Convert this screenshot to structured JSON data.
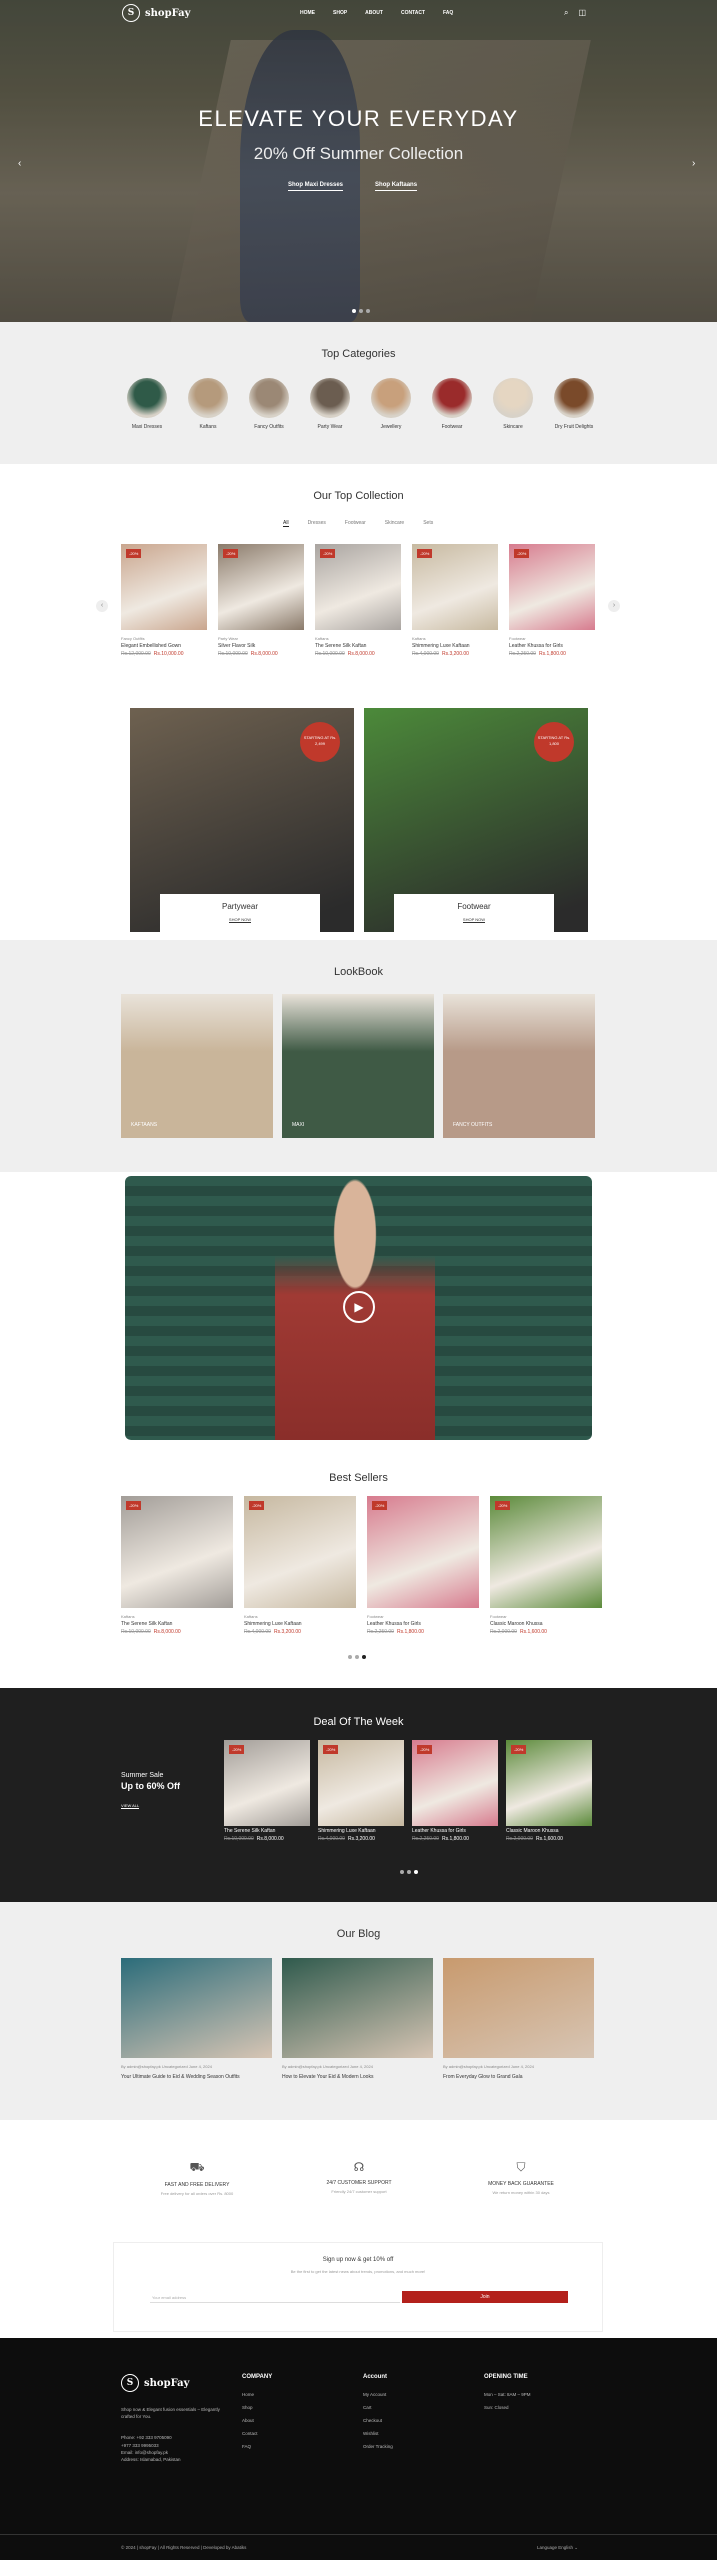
{
  "nav": {
    "logo": "shopFay",
    "menu": [
      "HOME",
      "SHOP",
      "ABOUT",
      "CONTACT",
      "FAQ"
    ]
  },
  "hero": {
    "title": "ELEVATE YOUR EVERYDAY",
    "subtitle": "20% Off Summer Collection",
    "buttons": [
      "Shop Maxi Dresses",
      "Shop Kaftaans"
    ]
  },
  "categories": {
    "title": "Top Categories",
    "items": [
      {
        "label": "Maxi Dresses",
        "color": "#2f5a48"
      },
      {
        "label": "Kaftans",
        "color": "#b59a7c"
      },
      {
        "label": "Fancy Outfits",
        "color": "#9b8875"
      },
      {
        "label": "Party Wear",
        "color": "#6b5d50"
      },
      {
        "label": "Jewellery",
        "color": "#c8a07c"
      },
      {
        "label": "Footwear",
        "color": "#9a2b2b"
      },
      {
        "label": "Skincare",
        "color": "#e5d6c2"
      },
      {
        "label": "Dry Fruit Delights",
        "color": "#7a4a2a"
      }
    ]
  },
  "collection": {
    "title": "Our Top Collection",
    "tabs": [
      "All",
      "Dresses",
      "Footwear",
      "Skincare",
      "Sets"
    ],
    "products": [
      {
        "badge": "-20%",
        "category": "Fancy Outfits",
        "name": "Elegant Embellished Gown",
        "old": "Rs.12,000.00",
        "price": "Rs.10,000.00",
        "color": "#c9a58d"
      },
      {
        "badge": "-20%",
        "category": "Party Wear",
        "name": "Silver Flavor Silk",
        "old": "Rs.10,000.00",
        "price": "Rs.8,000.00",
        "color": "#8a7a6a"
      },
      {
        "badge": "-20%",
        "category": "Kaftans",
        "name": "The Serene Silk Kaftan",
        "old": "Rs.10,000.00",
        "price": "Rs.8,000.00",
        "color": "#a9a4a0"
      },
      {
        "badge": "-20%",
        "category": "Kaftans",
        "name": "Shimmering Luxe Kaftaan",
        "old": "Rs.4,000.00",
        "price": "Rs.3,200.00",
        "color": "#c7b9a0"
      },
      {
        "badge": "-20%",
        "category": "Footwear",
        "name": "Leather Khussa for Girls",
        "old": "Rs.2,250.00",
        "price": "Rs.1,800.00",
        "color": "#d77b8e"
      }
    ]
  },
  "banners": [
    {
      "title": "Partywear",
      "cta": "SHOP NOW",
      "stamp": "STARTING AT Rs. 2,499",
      "color": "#6e6150"
    },
    {
      "title": "Footwear",
      "cta": "SHOP NOW",
      "stamp": "STARTING AT Rs. 1,800",
      "color": "#4c8a3a"
    }
  ],
  "lookbook": {
    "title": "LookBook",
    "items": [
      {
        "label": "KAFTAANS",
        "color": "#c9b59a"
      },
      {
        "label": "MAXI",
        "color": "#3f5a45"
      },
      {
        "label": "FANCY OUTFITS",
        "color": "#b79a88"
      }
    ]
  },
  "best": {
    "title": "Best Sellers",
    "products": [
      {
        "badge": "-20%",
        "category": "Kaftans",
        "name": "The Serene Silk Kaftan",
        "old": "Rs.10,000.00",
        "price": "Rs.8,000.00",
        "color": "#a29d98"
      },
      {
        "badge": "-20%",
        "category": "Kaftans",
        "name": "Shimmering Luxe Kaftaan",
        "old": "Rs.4,000.00",
        "price": "Rs.3,200.00",
        "color": "#c6b8a0"
      },
      {
        "badge": "-20%",
        "category": "Footwear",
        "name": "Leather Khussa for Girls",
        "old": "Rs.2,250.00",
        "price": "Rs.1,800.00",
        "color": "#d77b8e"
      },
      {
        "badge": "-20%",
        "category": "Footwear",
        "name": "Classic Maroon Khussa",
        "old": "Rs.2,000.00",
        "price": "Rs.1,600.00",
        "color": "#5b8a3a"
      }
    ]
  },
  "deal": {
    "title": "Deal Of The Week",
    "side_a": "Summer Sale",
    "side_b": "Up to 60% Off",
    "side_cta": "VIEW ALL",
    "products": [
      {
        "badge": "-20%",
        "name": "The Serene Silk Kaftan",
        "old": "Rs.10,000.00",
        "price": "Rs.8,000.00",
        "color": "#a29d98"
      },
      {
        "badge": "-20%",
        "name": "Shimmering Luxe Kaftaan",
        "old": "Rs.4,000.00",
        "price": "Rs.3,200.00",
        "color": "#c6b8a0"
      },
      {
        "badge": "-20%",
        "name": "Leather Khussa for Girls",
        "old": "Rs.2,250.00",
        "price": "Rs.1,800.00",
        "color": "#d77b8e"
      },
      {
        "badge": "-20%",
        "name": "Classic Maroon Khussa",
        "old": "Rs.2,000.00",
        "price": "Rs.1,600.00",
        "color": "#5b8a3a"
      }
    ]
  },
  "blog": {
    "title": "Our Blog",
    "posts": [
      {
        "meta": "By admin@shopfay.pk   Uncategorized   June 4, 2024",
        "title": "Your Ultimate Guide to Eid & Wedding Season Outfits",
        "color": "#2b6c7a"
      },
      {
        "meta": "By admin@shopfay.pk   Uncategorized   June 4, 2024",
        "title": "How to Elevate Your Eid & Modern Looks",
        "color": "#2f5a4d"
      },
      {
        "meta": "By admin@shopfay.pk   Uncategorized   June 4, 2024",
        "title": "From Everyday Glow to Grand Gala",
        "color": "#c89a6e"
      }
    ]
  },
  "features": [
    {
      "title": "FAST AND FREE DELIVERY",
      "sub": "Free delivery for all orders over Rs. 8000"
    },
    {
      "title": "24/7 CUSTOMER SUPPORT",
      "sub": "Friendly 24/7 customer support"
    },
    {
      "title": "MONEY BACK GUARANTEE",
      "sub": "We return money within 30 days"
    }
  ],
  "newsletter": {
    "title": "Sign up now & get 10% off",
    "sub": "Be the first to get the latest news about trends, promotions, and much more!",
    "placeholder": "Your email address",
    "button": "Join"
  },
  "footer": {
    "about": "Shop now & Elegant fusion essentials – Elegantly crafted for You.",
    "phone": "Phone: +92 333 9705090",
    "phone2": "+977 333 9995033",
    "email": "Email: info@shopfay.pk",
    "address": "Address: Islamabad, Pakistan",
    "company": {
      "title": "COMPANY",
      "items": [
        "Home",
        "Shop",
        "About",
        "Contact",
        "FAQ"
      ]
    },
    "account": {
      "title": "Account",
      "items": [
        "My Account",
        "Cart",
        "Checkout",
        "Wishlist",
        "Order Tracking"
      ]
    },
    "hours": {
      "title": "OPENING TIME",
      "items": [
        "Mon – Sat: 8AM – 9PM",
        "Sun: Closed"
      ]
    },
    "copyright": "© 2024 | shopFay | All Rights Reserved | Developed by Abatiks",
    "language": "Language   English  ⌄"
  }
}
